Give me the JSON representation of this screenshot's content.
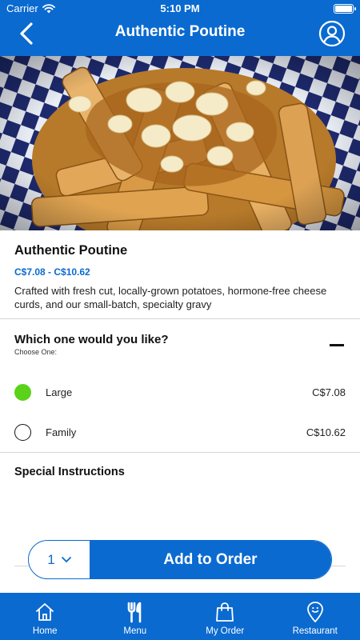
{
  "status_bar": {
    "carrier": "Carrier",
    "time": "5:10 PM"
  },
  "header": {
    "title": "Authentic Poutine",
    "back_icon": "chevron-left-icon",
    "profile_icon": "user-circle-icon"
  },
  "item": {
    "name": "Authentic Poutine",
    "price_range": "C$7.08 - C$10.62",
    "description": "Crafted with fresh cut, locally-grown potatoes, hormone-free cheese curds, and our small-batch, specialty gravy"
  },
  "option_group": {
    "title": "Which one would you like?",
    "subtitle": "Choose One:",
    "options": [
      {
        "label": "Large",
        "price": "C$7.08",
        "selected": true
      },
      {
        "label": "Family",
        "price": "C$10.62",
        "selected": false
      }
    ]
  },
  "special_instructions": {
    "label": "Special Instructions"
  },
  "order_bar": {
    "quantity": "1",
    "add_label": "Add to Order"
  },
  "tabbar": {
    "tabs": [
      {
        "label": "Home",
        "icon": "home-icon"
      },
      {
        "label": "Menu",
        "icon": "fork-knife-icon"
      },
      {
        "label": "My Order",
        "icon": "shopping-bag-icon"
      },
      {
        "label": "Restaurant",
        "icon": "location-pin-icon"
      }
    ]
  },
  "colors": {
    "brand_blue": "#0a6ad0",
    "selected_green": "#5bd21a"
  }
}
